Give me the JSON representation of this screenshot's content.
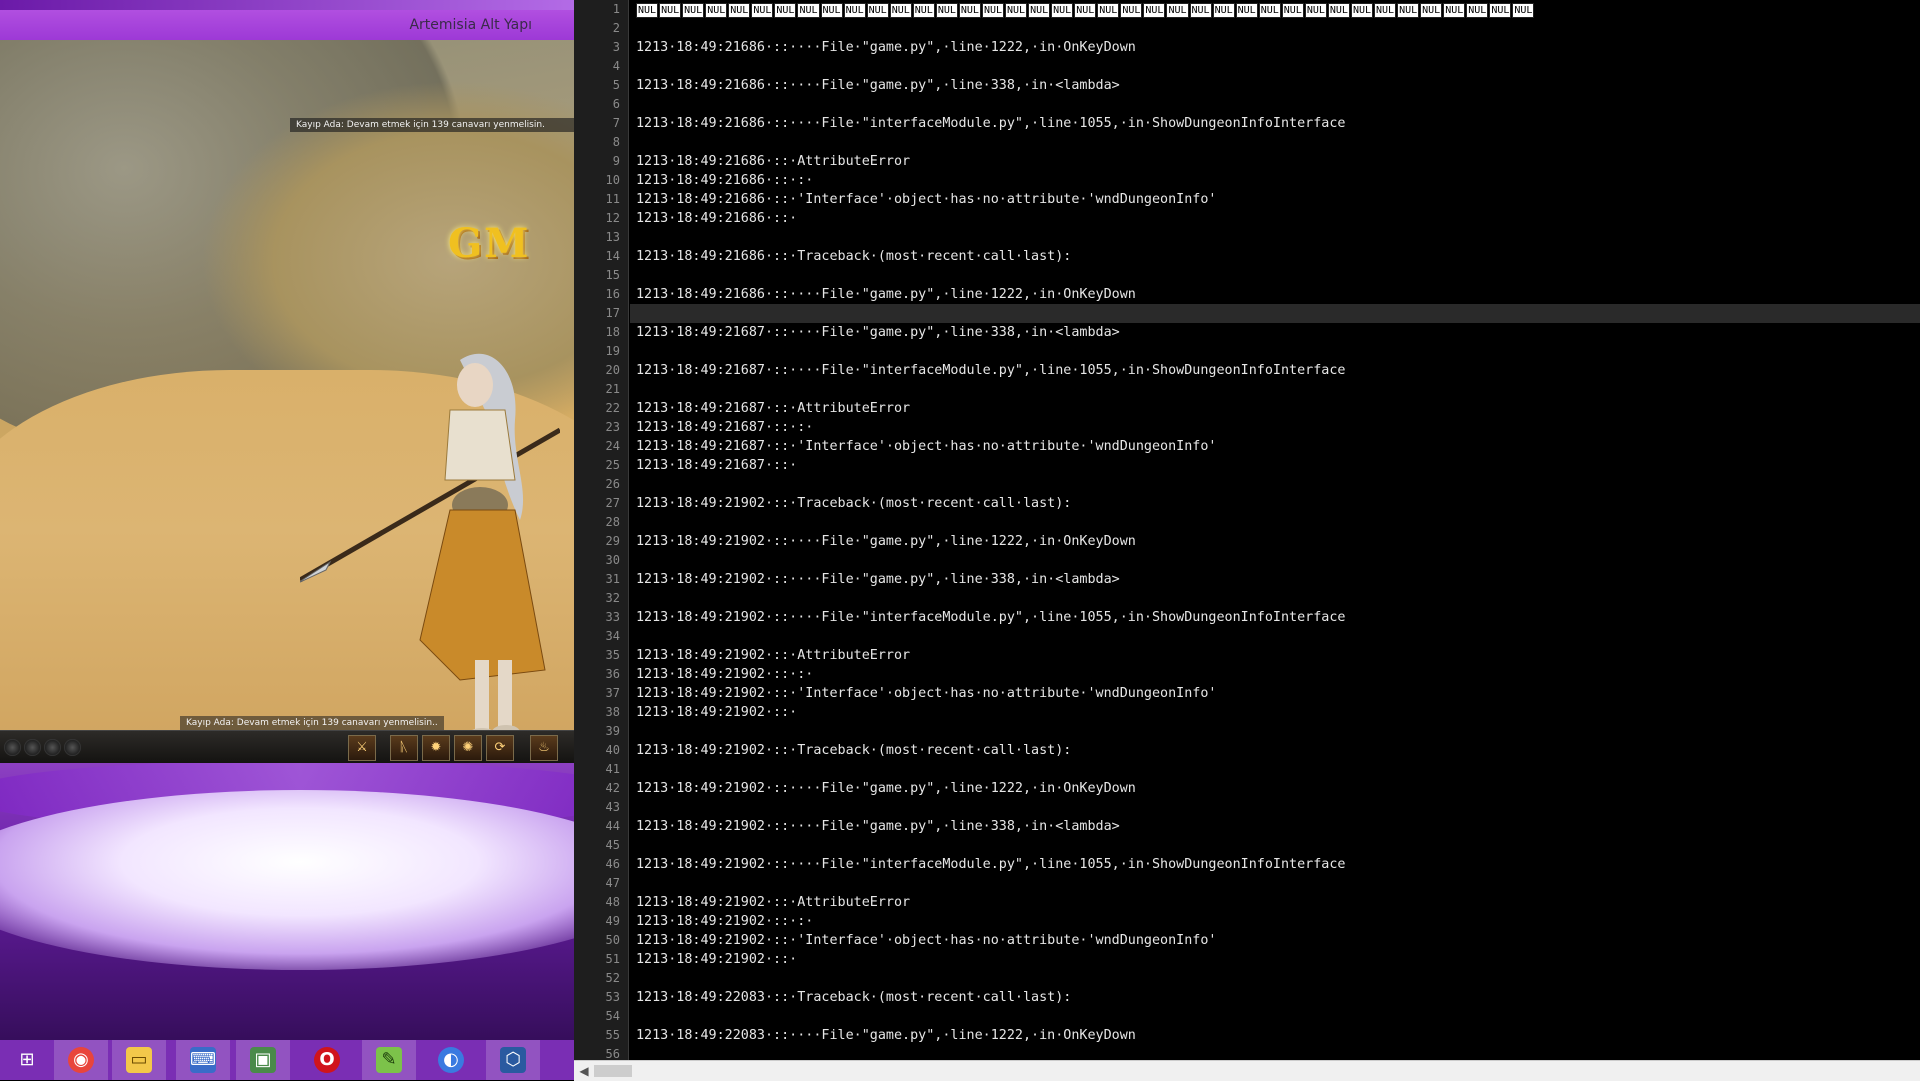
{
  "game_window": {
    "title": "Artemisia Alt Yapı",
    "notice_top": "Kayıp Ada: Devam etmek için 139 canavarı yenmelisin.",
    "notice_bottom": "Kayıp Ada: Devam etmek için 139 canavarı yenmelisin..",
    "logo_text": "GM",
    "hotbar": {
      "orbs": [
        "orb",
        "orb",
        "orb",
        "orb"
      ],
      "slots": [
        "⚔",
        "ᚣ",
        "✹",
        "✺",
        "⟳",
        "♨"
      ]
    }
  },
  "taskbar": {
    "items": [
      {
        "icon": "windows-start-icon",
        "glyph": "⊞"
      },
      {
        "icon": "chrome-icon",
        "glyph": "◉"
      },
      {
        "icon": "file-explorer-icon",
        "glyph": "▭"
      },
      {
        "icon": "network-tool-icon",
        "glyph": "⌨"
      },
      {
        "icon": "remote-desktop-icon",
        "glyph": "▣"
      },
      {
        "icon": "opera-icon",
        "glyph": "O"
      },
      {
        "icon": "notepad-plus-icon",
        "glyph": "✎"
      },
      {
        "icon": "firefox-icon",
        "glyph": "◐"
      },
      {
        "icon": "virtualbox-icon",
        "glyph": "⬡"
      }
    ]
  },
  "editor": {
    "current_line": 17,
    "line_numbers": [
      "1",
      "2",
      "3",
      "4",
      "5",
      "6",
      "7",
      "8",
      "9",
      "10",
      "11",
      "12",
      "13",
      "14",
      "15",
      "16",
      "17",
      "18",
      "19",
      "20",
      "21",
      "22",
      "23",
      "24",
      "25",
      "26",
      "27",
      "28",
      "29",
      "30",
      "31",
      "32",
      "33",
      "34",
      "35",
      "36",
      "37",
      "38",
      "39",
      "40",
      "41",
      "42",
      "43",
      "44",
      "45",
      "46",
      "47",
      "48",
      "49",
      "50",
      "51",
      "52",
      "53",
      "54",
      "55",
      "56"
    ],
    "nul_count": 39,
    "nul_label": "NUL",
    "lines": [
      "",
      "",
      "1213·18:49:21686·::····File·\"game.py\",·line·1222,·in·OnKeyDown",
      "",
      "1213·18:49:21686·::····File·\"game.py\",·line·338,·in·<lambda>",
      "",
      "1213·18:49:21686·::····File·\"interfaceModule.py\",·line·1055,·in·ShowDungeonInfoInterface",
      "",
      "1213·18:49:21686·::·AttributeError",
      "1213·18:49:21686·::·:·",
      "1213·18:49:21686·::·'Interface'·object·has·no·attribute·'wndDungeonInfo'",
      "1213·18:49:21686·::·",
      "",
      "1213·18:49:21686·::·Traceback·(most·recent·call·last):",
      "",
      "1213·18:49:21686·::····File·\"game.py\",·line·1222,·in·OnKeyDown",
      "",
      "1213·18:49:21687·::····File·\"game.py\",·line·338,·in·<lambda>",
      "",
      "1213·18:49:21687·::····File·\"interfaceModule.py\",·line·1055,·in·ShowDungeonInfoInterface",
      "",
      "1213·18:49:21687·::·AttributeError",
      "1213·18:49:21687·::·:·",
      "1213·18:49:21687·::·'Interface'·object·has·no·attribute·'wndDungeonInfo'",
      "1213·18:49:21687·::·",
      "",
      "1213·18:49:21902·::·Traceback·(most·recent·call·last):",
      "",
      "1213·18:49:21902·::····File·\"game.py\",·line·1222,·in·OnKeyDown",
      "",
      "1213·18:49:21902·::····File·\"game.py\",·line·338,·in·<lambda>",
      "",
      "1213·18:49:21902·::····File·\"interfaceModule.py\",·line·1055,·in·ShowDungeonInfoInterface",
      "",
      "1213·18:49:21902·::·AttributeError",
      "1213·18:49:21902·::·:·",
      "1213·18:49:21902·::·'Interface'·object·has·no·attribute·'wndDungeonInfo'",
      "1213·18:49:21902·::·",
      "",
      "1213·18:49:21902·::·Traceback·(most·recent·call·last):",
      "",
      "1213·18:49:21902·::····File·\"game.py\",·line·1222,·in·OnKeyDown",
      "",
      "1213·18:49:21902·::····File·\"game.py\",·line·338,·in·<lambda>",
      "",
      "1213·18:49:21902·::····File·\"interfaceModule.py\",·line·1055,·in·ShowDungeonInfoInterface",
      "",
      "1213·18:49:21902·::·AttributeError",
      "1213·18:49:21902·::·:·",
      "1213·18:49:21902·::·'Interface'·object·has·no·attribute·'wndDungeonInfo'",
      "1213·18:49:21902·::·",
      "",
      "1213·18:49:22083·::·Traceback·(most·recent·call·last):",
      "",
      "1213·18:49:22083·::····File·\"game.py\",·line·1222,·in·OnKeyDown",
      ""
    ]
  },
  "colors": {
    "editor_bg": "#000000",
    "editor_text": "#e6e6e6",
    "gutter_bg": "#1e1e1e",
    "taskbar_bg": "#7a2eb4",
    "game_title_bg": "#9d39d6"
  }
}
